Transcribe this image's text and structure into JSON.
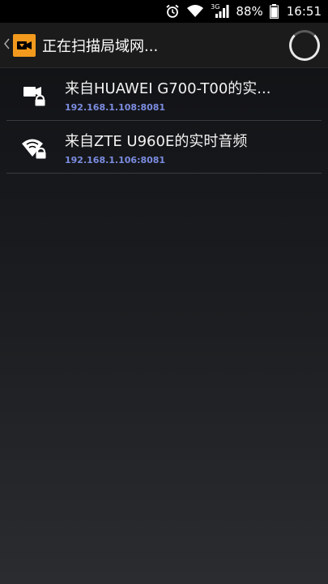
{
  "status_bar": {
    "network_label": "3G",
    "battery_percent": "88%",
    "time": "16:51",
    "icons": [
      "alarm-icon",
      "wifi-icon",
      "signal-icon",
      "battery-icon"
    ]
  },
  "action_bar": {
    "title": "正在扫描局域网...",
    "app_icon": "camera-icon",
    "progress_icon": "spinner-icon"
  },
  "devices": [
    {
      "title": "来自HUAWEI G700-T00的实...",
      "address": "192.168.1.108:8081",
      "icon": "camera-lock-icon"
    },
    {
      "title": "来自ZTE U960E的实时音频",
      "address": "192.168.1.106:8081",
      "icon": "wifi-lock-icon"
    }
  ],
  "colors": {
    "accent": "#f29a1d",
    "subtitle": "#7b8ce0",
    "background": "#1c1e21"
  }
}
